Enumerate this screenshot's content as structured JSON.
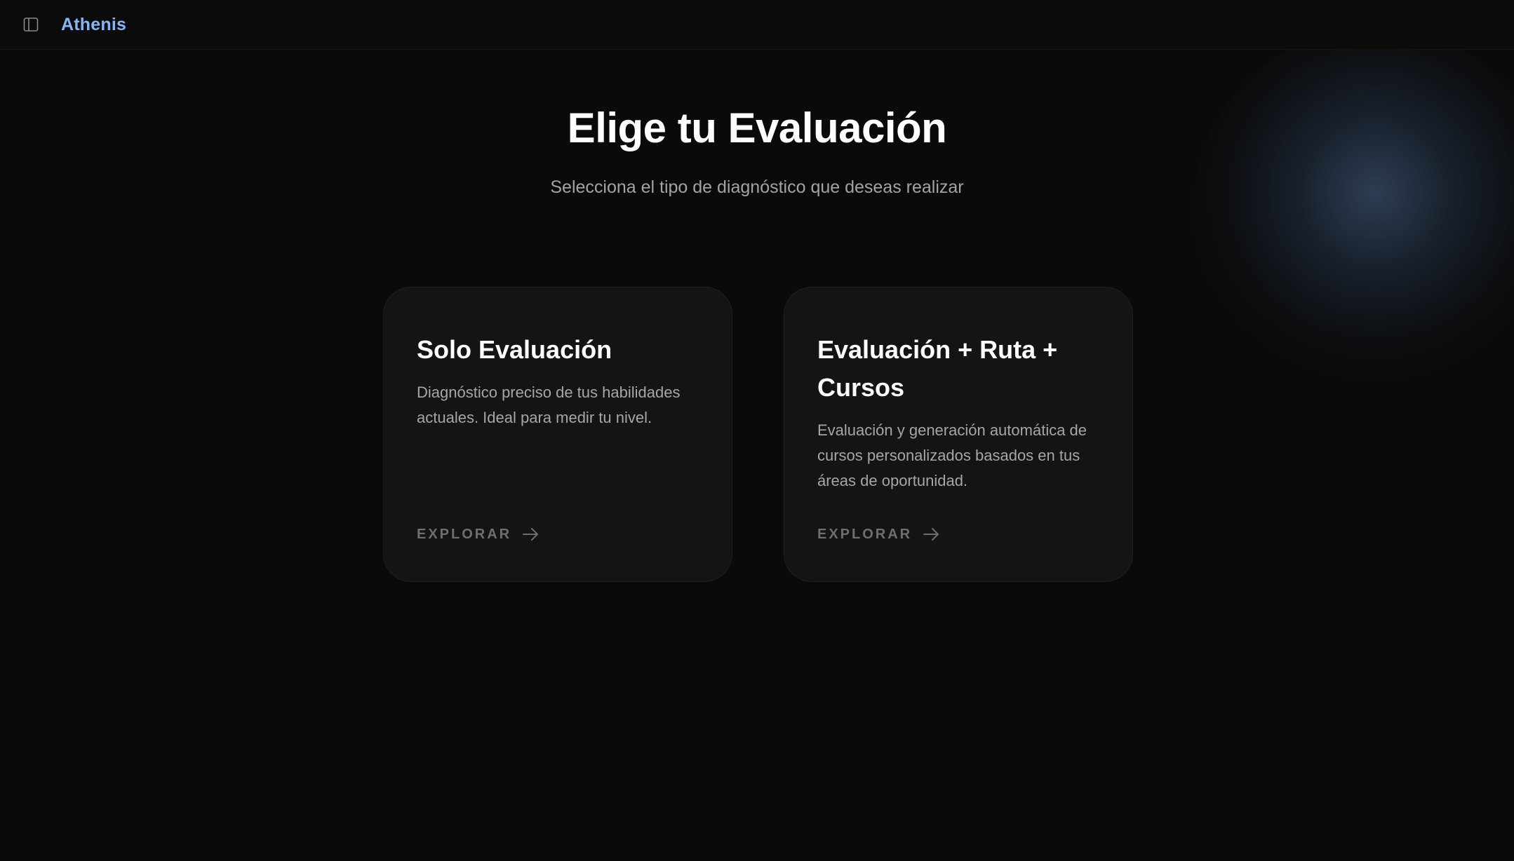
{
  "colors": {
    "brand": "#8ab4f8",
    "background": "#0a0a0a",
    "card": "#141414",
    "title": "#ffffff",
    "muted": "#a3a3a3",
    "cta": "#6e6e6e"
  },
  "header": {
    "toggle_icon": "sidebar-panel-icon",
    "brand": "Athenis"
  },
  "main": {
    "title": "Elige tu Evaluación",
    "subtitle": "Selecciona el tipo de diagnóstico que deseas realizar"
  },
  "cards": [
    {
      "title": "Solo Evaluación",
      "description": "Diagnóstico preciso de tus habilidades actuales. Ideal para medir tu nivel.",
      "cta": "EXPLORAR",
      "cta_icon": "arrow-right-icon"
    },
    {
      "title": "Evaluación + Ruta + Cursos",
      "description": "Evaluación y generación automática de cursos personalizados basados en tus áreas de oportunidad.",
      "cta": "EXPLORAR",
      "cta_icon": "arrow-right-icon"
    }
  ]
}
